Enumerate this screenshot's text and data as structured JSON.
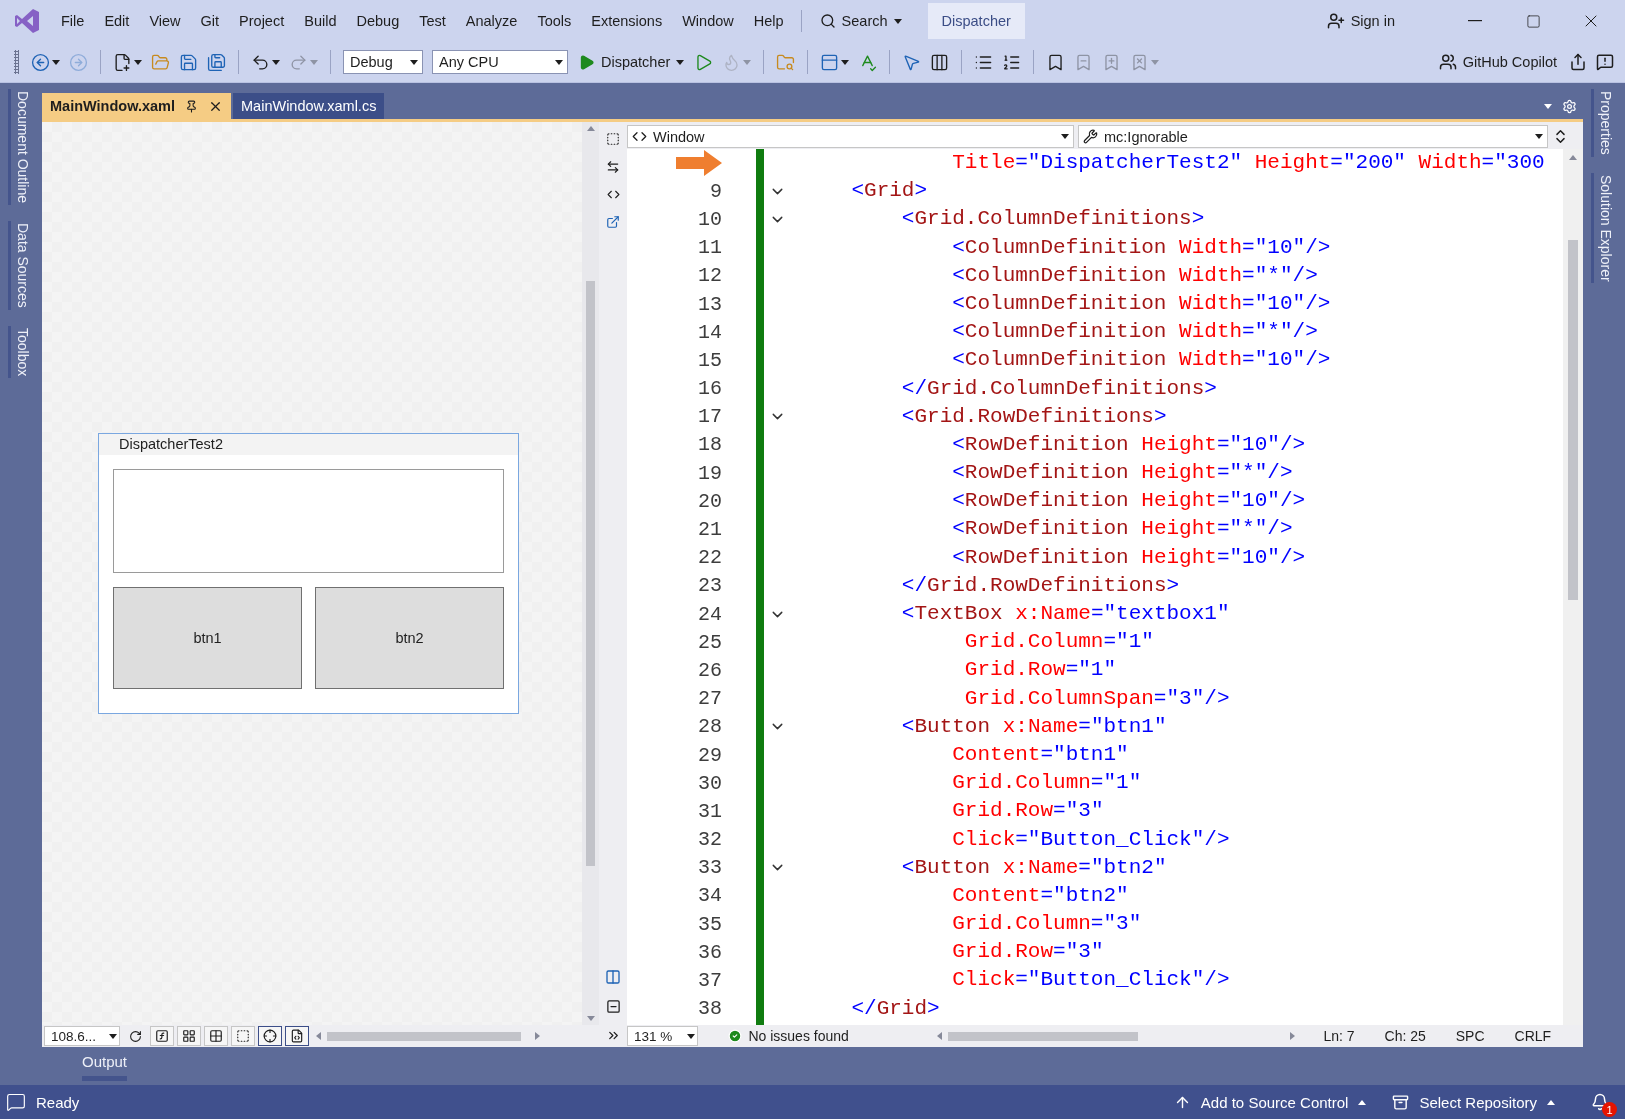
{
  "title_bar": {
    "menu": [
      "File",
      "Edit",
      "View",
      "Git",
      "Project",
      "Build",
      "Debug",
      "Test",
      "Analyze",
      "Tools",
      "Extensions",
      "Window",
      "Help"
    ],
    "search": "Search",
    "solution_name": "Dispatcher",
    "sign_in": "Sign in"
  },
  "toolbar": {
    "tools": [
      {
        "kind": "back",
        "disabled": false,
        "dropdown": true
      },
      {
        "kind": "forward",
        "disabled": true,
        "dropdown": false
      },
      {
        "kind": "separator"
      },
      {
        "kind": "new",
        "disabled": false,
        "dropdown": true
      },
      {
        "kind": "open",
        "disabled": false,
        "dropdown": false
      },
      {
        "kind": "save",
        "disabled": false,
        "dropdown": false
      },
      {
        "kind": "save_all",
        "disabled": false,
        "dropdown": false
      },
      {
        "kind": "separator"
      },
      {
        "kind": "undo",
        "disabled": false,
        "dropdown": true
      },
      {
        "kind": "redo",
        "disabled": true,
        "dropdown": true
      },
      {
        "kind": "separator"
      },
      {
        "kind": "configuration",
        "value": "Debug"
      },
      {
        "kind": "platform",
        "value": "Any CPU"
      },
      {
        "kind": "start",
        "label": "Dispatcher"
      },
      {
        "kind": "run",
        "disabled": false,
        "dropdown": false
      },
      {
        "kind": "hot_reload",
        "disabled": true,
        "dropdown": true
      },
      {
        "kind": "separator"
      },
      {
        "kind": "find",
        "disabled": false,
        "dropdown": false
      },
      {
        "kind": "separator"
      },
      {
        "kind": "layout",
        "disabled": false,
        "dropdown": true
      },
      {
        "kind": "spell",
        "disabled": false,
        "dropdown": false
      },
      {
        "kind": "separator"
      },
      {
        "kind": "select",
        "disabled": false,
        "dropdown": false
      },
      {
        "kind": "columns",
        "disabled": false,
        "dropdown": false
      },
      {
        "kind": "separator"
      },
      {
        "kind": "indent",
        "disabled": false,
        "dropdown": false
      },
      {
        "kind": "outdent",
        "disabled": false,
        "dropdown": false
      },
      {
        "kind": "separator"
      },
      {
        "kind": "bookmark",
        "disabled": false,
        "dropdown": false
      },
      {
        "kind": "bookmark_prev",
        "disabled": true,
        "dropdown": false
      },
      {
        "kind": "bookmark_next",
        "disabled": true,
        "dropdown": false
      },
      {
        "kind": "bookmark_clear",
        "disabled": true,
        "dropdown": true
      }
    ],
    "copilot": "GitHub Copilot"
  },
  "left_rail": [
    "Document Outline",
    "Data Sources",
    "Toolbox"
  ],
  "right_rail": [
    "Properties",
    "Solution Explorer"
  ],
  "document_tabs": [
    {
      "label": "MainWindow.xaml",
      "selected": true
    },
    {
      "label": "MainWindow.xaml.cs",
      "selected": false
    }
  ],
  "designer": {
    "window_title": "DispatcherTest2",
    "buttons": [
      "btn1",
      "btn2"
    ],
    "zoom": "108.6..."
  },
  "editor": {
    "element_dropdown": "Window",
    "member_dropdown": "mc:Ignorable",
    "zoom": "131 %",
    "issues": "No issues found",
    "status": [
      "Ln: 7",
      "Ch: 25",
      "SPC",
      "CRLF"
    ],
    "lines": [
      {
        "current": true,
        "fold": false,
        "text": "            Title=\"DispatcherTest2\" Height=\"200\" Width=\"300"
      },
      {
        "number": "9",
        "current": false,
        "fold": true,
        "text": "    <Grid>"
      },
      {
        "number": "10",
        "current": false,
        "fold": true,
        "text": "        <Grid.ColumnDefinitions>"
      },
      {
        "number": "11",
        "current": false,
        "fold": false,
        "text": "            <ColumnDefinition Width=\"10\"/>"
      },
      {
        "number": "12",
        "current": false,
        "fold": false,
        "text": "            <ColumnDefinition Width=\"*\"/>"
      },
      {
        "number": "13",
        "current": false,
        "fold": false,
        "text": "            <ColumnDefinition Width=\"10\"/>"
      },
      {
        "number": "14",
        "current": false,
        "fold": false,
        "text": "            <ColumnDefinition Width=\"*\"/>"
      },
      {
        "number": "15",
        "current": false,
        "fold": false,
        "text": "            <ColumnDefinition Width=\"10\"/>"
      },
      {
        "number": "16",
        "current": false,
        "fold": false,
        "text": "        </Grid.ColumnDefinitions>"
      },
      {
        "number": "17",
        "current": false,
        "fold": true,
        "text": "        <Grid.RowDefinitions>"
      },
      {
        "number": "18",
        "current": false,
        "fold": false,
        "text": "            <RowDefinition Height=\"10\"/>"
      },
      {
        "number": "19",
        "current": false,
        "fold": false,
        "text": "            <RowDefinition Height=\"*\"/>"
      },
      {
        "number": "20",
        "current": false,
        "fold": false,
        "text": "            <RowDefinition Height=\"10\"/>"
      },
      {
        "number": "21",
        "current": false,
        "fold": false,
        "text": "            <RowDefinition Height=\"*\"/>"
      },
      {
        "number": "22",
        "current": false,
        "fold": false,
        "text": "            <RowDefinition Height=\"10\"/>"
      },
      {
        "number": "23",
        "current": false,
        "fold": false,
        "text": "        </Grid.RowDefinitions>"
      },
      {
        "number": "24",
        "current": false,
        "fold": true,
        "text": "        <TextBox x:Name=\"textbox1\""
      },
      {
        "number": "25",
        "current": false,
        "fold": false,
        "text": "             Grid.Column=\"1\""
      },
      {
        "number": "26",
        "current": false,
        "fold": false,
        "text": "             Grid.Row=\"1\""
      },
      {
        "number": "27",
        "current": false,
        "fold": false,
        "text": "             Grid.ColumnSpan=\"3\"/>"
      },
      {
        "number": "28",
        "current": false,
        "fold": true,
        "text": "        <Button x:Name=\"btn1\""
      },
      {
        "number": "29",
        "current": false,
        "fold": false,
        "text": "            Content=\"btn1\""
      },
      {
        "number": "30",
        "current": false,
        "fold": false,
        "text": "            Grid.Column=\"1\""
      },
      {
        "number": "31",
        "current": false,
        "fold": false,
        "text": "            Grid.Row=\"3\""
      },
      {
        "number": "32",
        "current": false,
        "fold": false,
        "text": "            Click=\"Button_Click\"/>"
      },
      {
        "number": "33",
        "current": false,
        "fold": true,
        "text": "        <Button x:Name=\"btn2\""
      },
      {
        "number": "34",
        "current": false,
        "fold": false,
        "text": "            Content=\"btn2\""
      },
      {
        "number": "35",
        "current": false,
        "fold": false,
        "text": "            Grid.Column=\"3\""
      },
      {
        "number": "36",
        "current": false,
        "fold": false,
        "text": "            Grid.Row=\"3\""
      },
      {
        "number": "37",
        "current": false,
        "fold": false,
        "text": "            Click=\"Button_Click\"/>"
      },
      {
        "number": "38",
        "current": false,
        "fold": false,
        "text": "    </Grid>"
      }
    ]
  },
  "output_tab": "Output",
  "status_bar": {
    "state": "Ready",
    "source_control": "Add to Source Control",
    "repository": "Select Repository",
    "notifications": "1"
  }
}
